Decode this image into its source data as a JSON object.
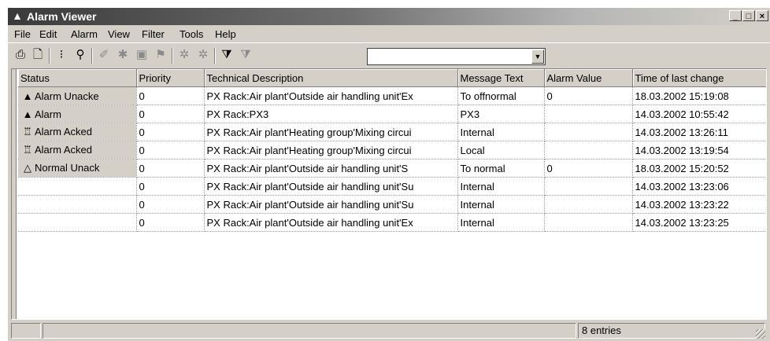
{
  "window": {
    "title": "Alarm Viewer",
    "controls": {
      "minimize": "_",
      "maximize": "□",
      "close": "×"
    }
  },
  "menu": [
    "File",
    "Edit",
    "Alarm",
    "View",
    "Filter",
    "Tools",
    "Help"
  ],
  "toolbar": {
    "icons": [
      "print-icon",
      "print-preview-icon",
      "tree-icon",
      "find-binoculars-icon",
      "acknowledge-icon",
      "acknowledge-all-icon",
      "video-icon",
      "disable-icon",
      "block-icon",
      "unblock-icon",
      "filter-icon",
      "filter-edit-icon"
    ],
    "combo_value": ""
  },
  "table": {
    "columns": [
      "Status",
      "Priority",
      "Technical Description",
      "Message Text",
      "Alarm Value",
      "Time of last change"
    ],
    "rows": [
      {
        "status": "Alarm Unacke",
        "status_icon": "alarm-bell-icon",
        "priority": "0",
        "description": "PX Rack:Air plant'Outside air handling unit'Ex",
        "message": "To offnormal",
        "value": "0",
        "time": "18.03.2002 15:19:08"
      },
      {
        "status": "Alarm",
        "status_icon": "alarm-bell-icon",
        "priority": "0",
        "description": "PX Rack:PX3",
        "message": "PX3",
        "value": "",
        "time": "14.03.2002 10:55:42"
      },
      {
        "status": "Alarm Acked",
        "status_icon": "acked-bell-icon",
        "priority": "0",
        "description": "PX Rack:Air plant'Heating group'Mixing circui",
        "message": "Internal",
        "value": "",
        "time": "14.03.2002 13:26:11"
      },
      {
        "status": "Alarm Acked",
        "status_icon": "acked-bell-icon",
        "priority": "0",
        "description": "PX Rack:Air plant'Heating group'Mixing circui",
        "message": "Local",
        "value": "",
        "time": "14.03.2002 13:19:54"
      },
      {
        "status": "Normal Unack",
        "status_icon": "normal-bell-icon",
        "priority": "0",
        "description": "PX Rack:Air plant'Outside air handling unit'S",
        "message": "To normal",
        "value": "0",
        "time": "18.03.2002 15:20:52"
      },
      {
        "status": "",
        "status_icon": "",
        "priority": "0",
        "description": "PX Rack:Air plant'Outside air handling unit'Su",
        "message": "Internal",
        "value": "",
        "time": "14.03.2002 13:23:06"
      },
      {
        "status": "",
        "status_icon": "",
        "priority": "0",
        "description": "PX Rack:Air plant'Outside air handling unit'Su",
        "message": "Internal",
        "value": "",
        "time": "14.03.2002 13:23:22"
      },
      {
        "status": "",
        "status_icon": "",
        "priority": "0",
        "description": "PX Rack:Air plant'Outside air handling unit'Ex",
        "message": "Internal",
        "value": "",
        "time": "14.03.2002 13:23:25"
      }
    ]
  },
  "statusbar": {
    "entries": "8 entries"
  }
}
